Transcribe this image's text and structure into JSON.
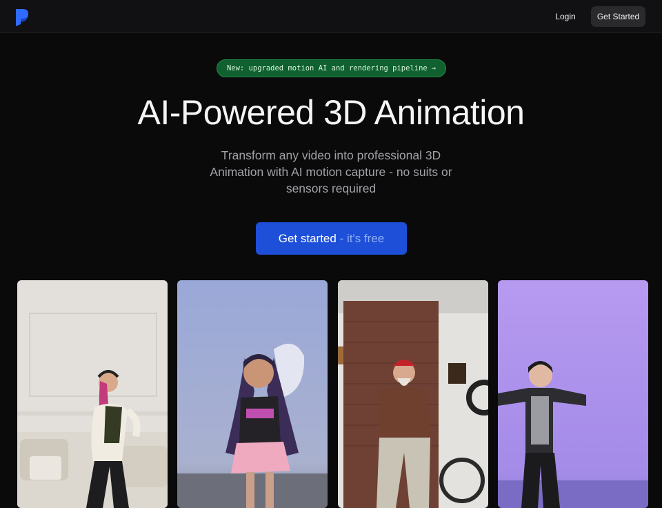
{
  "nav": {
    "login_label": "Login",
    "cta_label": "Get Started"
  },
  "announcement": {
    "text": "New: upgraded motion AI and rendering pipeline",
    "arrow": "→"
  },
  "hero": {
    "title": "AI-Powered 3D Animation",
    "subtitle": "Transform any video into professional 3D Animation with AI motion capture - no suits or sensors required",
    "cta_main": "Get started",
    "cta_suffix": " - it's free"
  },
  "showcase": {
    "cards": [
      {
        "subject": "woman-dancing-video"
      },
      {
        "subject": "anime-character-render"
      },
      {
        "subject": "man-dancing-video"
      },
      {
        "subject": "boy-character-render"
      }
    ]
  },
  "colors": {
    "background": "#0a0a0b",
    "topbar": "#111113",
    "accent": "#1d4fd8",
    "announcement": "#10612f",
    "logo": "#2f6bff"
  }
}
